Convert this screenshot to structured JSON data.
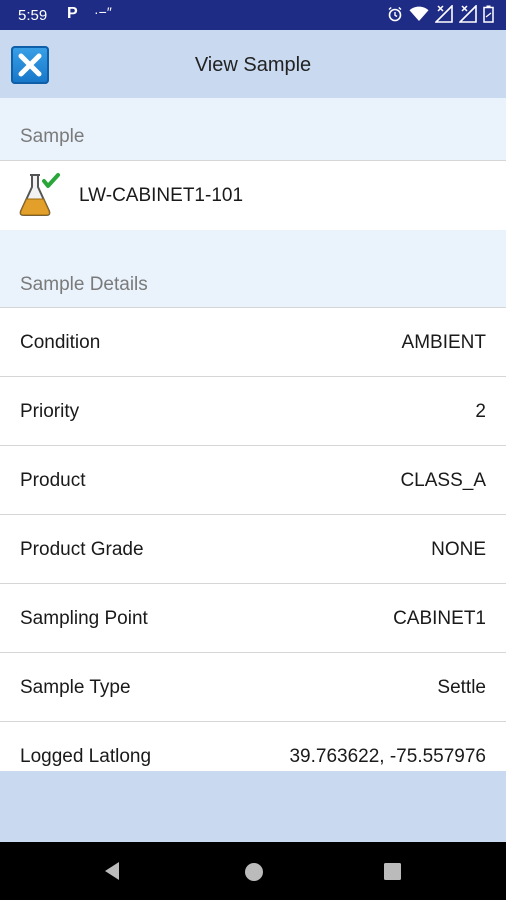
{
  "status_bar": {
    "time": "5:59",
    "p_icon": "P",
    "misc": "·−″"
  },
  "header": {
    "title": "View Sample",
    "close_icon": "close-x-icon"
  },
  "sample_section": {
    "header": "Sample",
    "sample_id": "LW-CABINET1-101",
    "icon": "flask-check-icon"
  },
  "details_section": {
    "header": "Sample Details",
    "rows": [
      {
        "label": "Condition",
        "value": "AMBIENT"
      },
      {
        "label": "Priority",
        "value": "2"
      },
      {
        "label": "Product",
        "value": "CLASS_A"
      },
      {
        "label": "Product Grade",
        "value": "NONE"
      },
      {
        "label": "Sampling Point",
        "value": "CABINET1"
      },
      {
        "label": "Sample Type",
        "value": "Settle"
      },
      {
        "label": "Logged Latlong",
        "value": "39.763622, -75.557976"
      }
    ]
  },
  "colors": {
    "status_bar": "#1f2c86",
    "app_bar": "#c9d9f0",
    "section_header": "#eaf3fc",
    "close_button": "#1676c8"
  }
}
